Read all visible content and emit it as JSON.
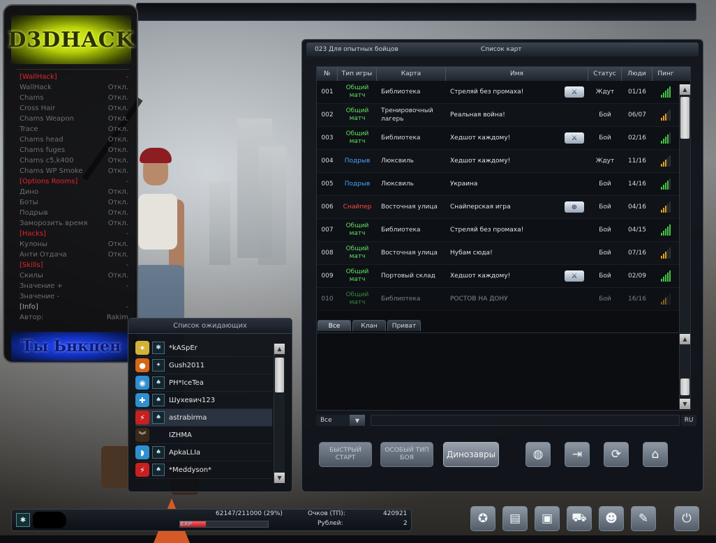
{
  "cheat_menu": {
    "logo": "D3DHACK",
    "footer": "Ты Ьнкпен",
    "rows": [
      {
        "label": "[WallHack]",
        "value": "-",
        "kind": "sec"
      },
      {
        "label": "WallHack",
        "value": "Откл.",
        "kind": "item"
      },
      {
        "label": "Chams",
        "value": "Откл.",
        "kind": "item"
      },
      {
        "label": "Cross Hair",
        "value": "Откл.",
        "kind": "item"
      },
      {
        "label": "Chams Weapon",
        "value": "Откл.",
        "kind": "item"
      },
      {
        "label": "Trace",
        "value": "Откл.",
        "kind": "item"
      },
      {
        "label": "Chams head",
        "value": "Откл.",
        "kind": "item"
      },
      {
        "label": "Chams fuges",
        "value": "Откл.",
        "kind": "item"
      },
      {
        "label": "Chams c5,k400",
        "value": "Откл.",
        "kind": "item"
      },
      {
        "label": "Chams WP Smoke",
        "value": "Откл.",
        "kind": "item"
      },
      {
        "label": "[Options Rooms]",
        "value": "-",
        "kind": "sec"
      },
      {
        "label": "Дино",
        "value": "Откл.",
        "kind": "item"
      },
      {
        "label": "Боты",
        "value": "Откл.",
        "kind": "item"
      },
      {
        "label": "Подрыв",
        "value": "Откл.",
        "kind": "item"
      },
      {
        "label": "Заморозить время",
        "value": "Откл.",
        "kind": "item"
      },
      {
        "label": "[Hacks]",
        "value": "-",
        "kind": "sec"
      },
      {
        "label": "Кулоны",
        "value": "Откл.",
        "kind": "item"
      },
      {
        "label": "Анти Отдача",
        "value": "Откл.",
        "kind": "item"
      },
      {
        "label": "[Skills]",
        "value": "-",
        "kind": "sec"
      },
      {
        "label": "Скилы",
        "value": "Откл.",
        "kind": "item"
      },
      {
        "label": "Значение +",
        "value": "-",
        "kind": "item"
      },
      {
        "label": "Значение -",
        "value": "",
        "kind": "item"
      },
      {
        "label": "[Info]",
        "value": "-",
        "kind": "info"
      },
      {
        "label": "Автор:",
        "value": "Rakim",
        "kind": "item"
      }
    ]
  },
  "waiting": {
    "title": "Список ожидающих",
    "players": [
      {
        "name": "*kASpEr",
        "rank_color": "#d4b23a",
        "rank_glyph": "✦",
        "clan_glyph": "✱"
      },
      {
        "name": "Gush2011",
        "rank_color": "#d6661a",
        "rank_glyph": "●",
        "clan_glyph": "✦"
      },
      {
        "name": "PH*IceTea",
        "rank_color": "#2f8fd0",
        "rank_glyph": "◉",
        "clan_glyph": "♠"
      },
      {
        "name": "Шухевич123",
        "rank_color": "#2f8fd0",
        "rank_glyph": "✚",
        "clan_glyph": "♠"
      },
      {
        "name": "astrabirma",
        "rank_color": "#c82020",
        "rank_glyph": "⚡",
        "clan_glyph": "♠"
      },
      {
        "name": "IZHMA",
        "rank_color": "#3a2a1a",
        "rank_glyph": "︾",
        "clan_glyph": ""
      },
      {
        "name": "ApkaLLIa",
        "rank_color": "#2f8fd0",
        "rank_glyph": "◗",
        "clan_glyph": "♠"
      },
      {
        "name": "*Meddyson*",
        "rank_color": "#c82020",
        "rank_glyph": "⚡",
        "clan_glyph": "♠"
      }
    ]
  },
  "rooms": {
    "server": "023 Для опытных бойцов",
    "title": "Список карт",
    "columns": [
      "№",
      "Тип игры",
      "Карта",
      "Имя",
      "Статус",
      "Люди",
      "Пинг"
    ],
    "rows": [
      {
        "no": "001",
        "type": "Общий матч",
        "type_color": "green",
        "map": "Библиотека",
        "name": "Стреляй без промаха!",
        "icon": "knife-icon",
        "status": "Ждут",
        "people": "01/16",
        "ping": 5,
        "ping_color": "#45c645"
      },
      {
        "no": "002",
        "type": "Общий матч",
        "type_color": "green",
        "map": "Тренировочный лагерь",
        "name": "Реальная война!",
        "icon": "",
        "status": "Бой",
        "people": "06/07",
        "ping": 3,
        "ping_color": "#e0a020"
      },
      {
        "no": "003",
        "type": "Общий матч",
        "type_color": "green",
        "map": "Библиотека",
        "name": "Хедшот каждому!",
        "icon": "knife-icon",
        "status": "Бой",
        "people": "02/16",
        "ping": 4,
        "ping_color": "#45c645"
      },
      {
        "no": "004",
        "type": "Подрыв",
        "type_color": "blue",
        "map": "Люксвиль",
        "name": "Хедшот каждому!",
        "icon": "",
        "status": "Ждут",
        "people": "11/16",
        "ping": 3,
        "ping_color": "#e0a020"
      },
      {
        "no": "005",
        "type": "Подрыв",
        "type_color": "blue",
        "map": "Люксвиль",
        "name": "Украина",
        "icon": "",
        "status": "Бой",
        "people": "14/16",
        "ping": 4,
        "ping_color": "#45c645"
      },
      {
        "no": "006",
        "type": "Снайпер",
        "type_color": "red",
        "map": "Восточная улица",
        "name": "Снайперская игра",
        "icon": "crosshair-icon",
        "status": "Бой",
        "people": "04/16",
        "ping": 3,
        "ping_color": "#e0a020"
      },
      {
        "no": "007",
        "type": "Общий матч",
        "type_color": "green",
        "map": "Библиотека",
        "name": "Стреляй без промаха!",
        "icon": "",
        "status": "Бой",
        "people": "04/15",
        "ping": 5,
        "ping_color": "#45c645"
      },
      {
        "no": "008",
        "type": "Общий матч",
        "type_color": "green",
        "map": "Восточная улица",
        "name": "Нубам сюда!",
        "icon": "",
        "status": "Бой",
        "people": "07/16",
        "ping": 3,
        "ping_color": "#e0a020"
      },
      {
        "no": "009",
        "type": "Общий матч",
        "type_color": "green",
        "map": "Портовый склад",
        "name": "Хедшот каждому!",
        "icon": "knife-icon",
        "status": "Бой",
        "people": "02/09",
        "ping": 5,
        "ping_color": "#45c645"
      },
      {
        "no": "010",
        "type": "Общий матч",
        "type_color": "green",
        "map": "Библиотека",
        "name": "РОСТОВ НА ДОНУ",
        "icon": "",
        "status": "Бой",
        "people": "16/16",
        "ping": 3,
        "ping_color": "#e0a020"
      }
    ],
    "tabs": [
      "Все",
      "Клан",
      "Приват"
    ],
    "chat_channel": "Все",
    "chat_lang": "RU",
    "buttons": {
      "quick_start": "БЫСТРЫЙ СТАРТ",
      "special_type": "ОСОБЫЙ ТИП БОЯ",
      "dinos": "Динозавры"
    }
  },
  "status": {
    "exp_text": "62147/211000 (29%)",
    "exp_fraction": 0.29,
    "exp_label": "EXP",
    "points_label": "Очков (ТП):",
    "points_value": "420921",
    "rubles_label": "Рублей:",
    "rubles_value": "2"
  }
}
